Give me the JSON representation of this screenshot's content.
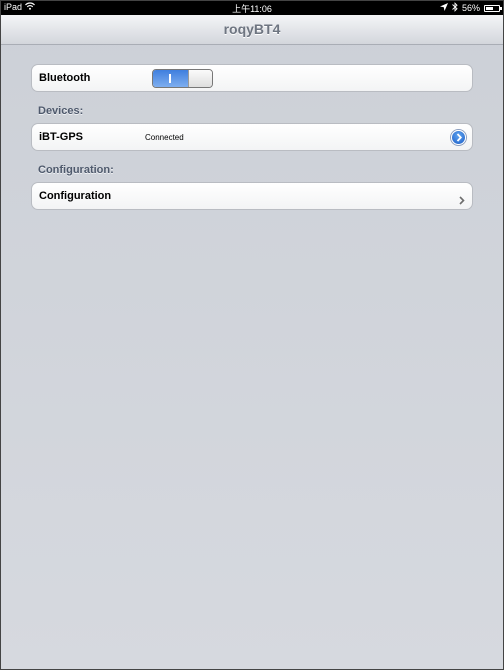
{
  "status_bar": {
    "device": "iPad",
    "time": "上午11:06",
    "battery": "56%",
    "icons": [
      "wifi-icon",
      "location-arrow-icon",
      "bluetooth-icon",
      "battery-icon"
    ]
  },
  "nav": {
    "title": "roqyBT4"
  },
  "bluetooth": {
    "label": "Bluetooth",
    "enabled": true
  },
  "devices": {
    "header": "Devices:",
    "items": [
      {
        "name": "iBT-GPS",
        "status": "Connected"
      }
    ]
  },
  "configuration": {
    "header": "Configuration:",
    "item_label": "Configuration"
  },
  "colors": {
    "accent": "#3f7fde",
    "section_header": "#4e596c",
    "nav_title": "#6e7581"
  }
}
